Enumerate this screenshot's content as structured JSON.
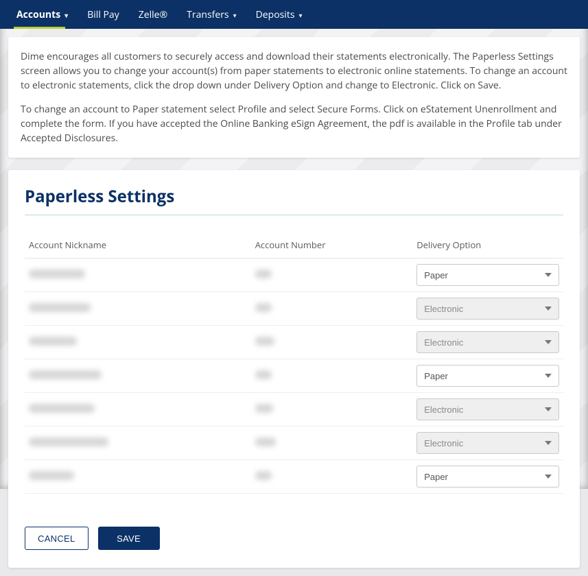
{
  "nav": {
    "items": [
      {
        "label": "Accounts",
        "has_dropdown": true,
        "active": true
      },
      {
        "label": "Bill Pay",
        "has_dropdown": false,
        "active": false
      },
      {
        "label": "Zelle®",
        "has_dropdown": false,
        "active": false
      },
      {
        "label": "Transfers",
        "has_dropdown": true,
        "active": false
      },
      {
        "label": "Deposits",
        "has_dropdown": true,
        "active": false
      }
    ]
  },
  "intro": {
    "p1": "Dime encourages all customers to securely access and download their statements electronically. The Paperless Settings screen allows you to change your account(s) from paper statements to electronic online statements. To change an account to electronic statements, click the drop down under Delivery Option and change to Electronic. Click on Save.",
    "p2": "To change an account to Paper statement select Profile and select Secure Forms. Click on eStatement Unenrollment and complete the form. If you have accepted the Online Banking eSign Agreement, the pdf is available in the Profile tab under Accepted Disclosures."
  },
  "page": {
    "title": "Paperless Settings",
    "columns": {
      "nickname": "Account Nickname",
      "number": "Account Number",
      "delivery": "Delivery Option"
    },
    "delivery_options": [
      "Paper",
      "Electronic"
    ],
    "rows": [
      {
        "nick_w": 82,
        "num_w": 24,
        "delivery": "Paper",
        "locked": false
      },
      {
        "nick_w": 90,
        "num_w": 24,
        "delivery": "Electronic",
        "locked": true
      },
      {
        "nick_w": 70,
        "num_w": 28,
        "delivery": "Electronic",
        "locked": true
      },
      {
        "nick_w": 106,
        "num_w": 24,
        "delivery": "Paper",
        "locked": false
      },
      {
        "nick_w": 96,
        "num_w": 26,
        "delivery": "Electronic",
        "locked": true
      },
      {
        "nick_w": 116,
        "num_w": 30,
        "delivery": "Electronic",
        "locked": true
      },
      {
        "nick_w": 66,
        "num_w": 24,
        "delivery": "Paper",
        "locked": false
      }
    ],
    "buttons": {
      "cancel": "CANCEL",
      "save": "SAVE"
    }
  }
}
